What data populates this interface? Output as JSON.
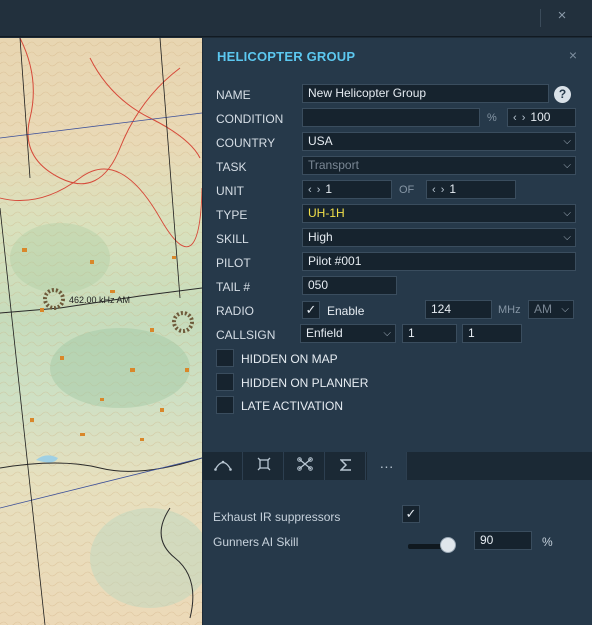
{
  "window": {
    "close_glyph": "×"
  },
  "map": {
    "marker_label": "462.00 kHz AM"
  },
  "panel": {
    "title": "HELICOPTER GROUP",
    "close_glyph": "×",
    "help_glyph": "?",
    "labels": {
      "name": "NAME",
      "condition": "CONDITION",
      "country": "COUNTRY",
      "task": "TASK",
      "unit": "UNIT",
      "type": "TYPE",
      "skill": "SKILL",
      "pilot": "PILOT",
      "tail": "TAIL #",
      "radio": "RADIO",
      "callsign": "CALLSIGN"
    },
    "values": {
      "name": "New Helicopter Group",
      "condition": "",
      "condition_unit": "%",
      "condition_percent": "100",
      "country": "USA",
      "task": "Transport",
      "unit_current": "1",
      "unit_of": "OF",
      "unit_total": "1",
      "type": "UH-1H",
      "skill": "High",
      "pilot": "Pilot #001",
      "tail": "050",
      "radio_enable_label": "Enable",
      "radio_freq": "124",
      "radio_unit": "MHz",
      "radio_mod": "AM",
      "callsign_name": "Enfield",
      "callsign_num1": "1",
      "callsign_num2": "1"
    },
    "checks": {
      "hidden_on_map": "HIDDEN ON MAP",
      "hidden_on_planner": "HIDDEN ON PLANNER",
      "late_activation": "LATE ACTIVATION"
    },
    "tabs": [
      {
        "icon": "route-icon"
      },
      {
        "icon": "target-icon"
      },
      {
        "icon": "payload-icon"
      },
      {
        "icon": "summary-icon"
      },
      {
        "icon": "more-icon",
        "glyph": "···"
      }
    ],
    "options": {
      "exhaust_label": "Exhaust IR suppressors",
      "gunners_label": "Gunners AI Skill",
      "gunners_value": "90",
      "gunners_unit": "%"
    }
  },
  "colors": {
    "accent": "#5cc8f0",
    "panel_bg": "#26394a",
    "type_highlight": "#f2e04a"
  }
}
